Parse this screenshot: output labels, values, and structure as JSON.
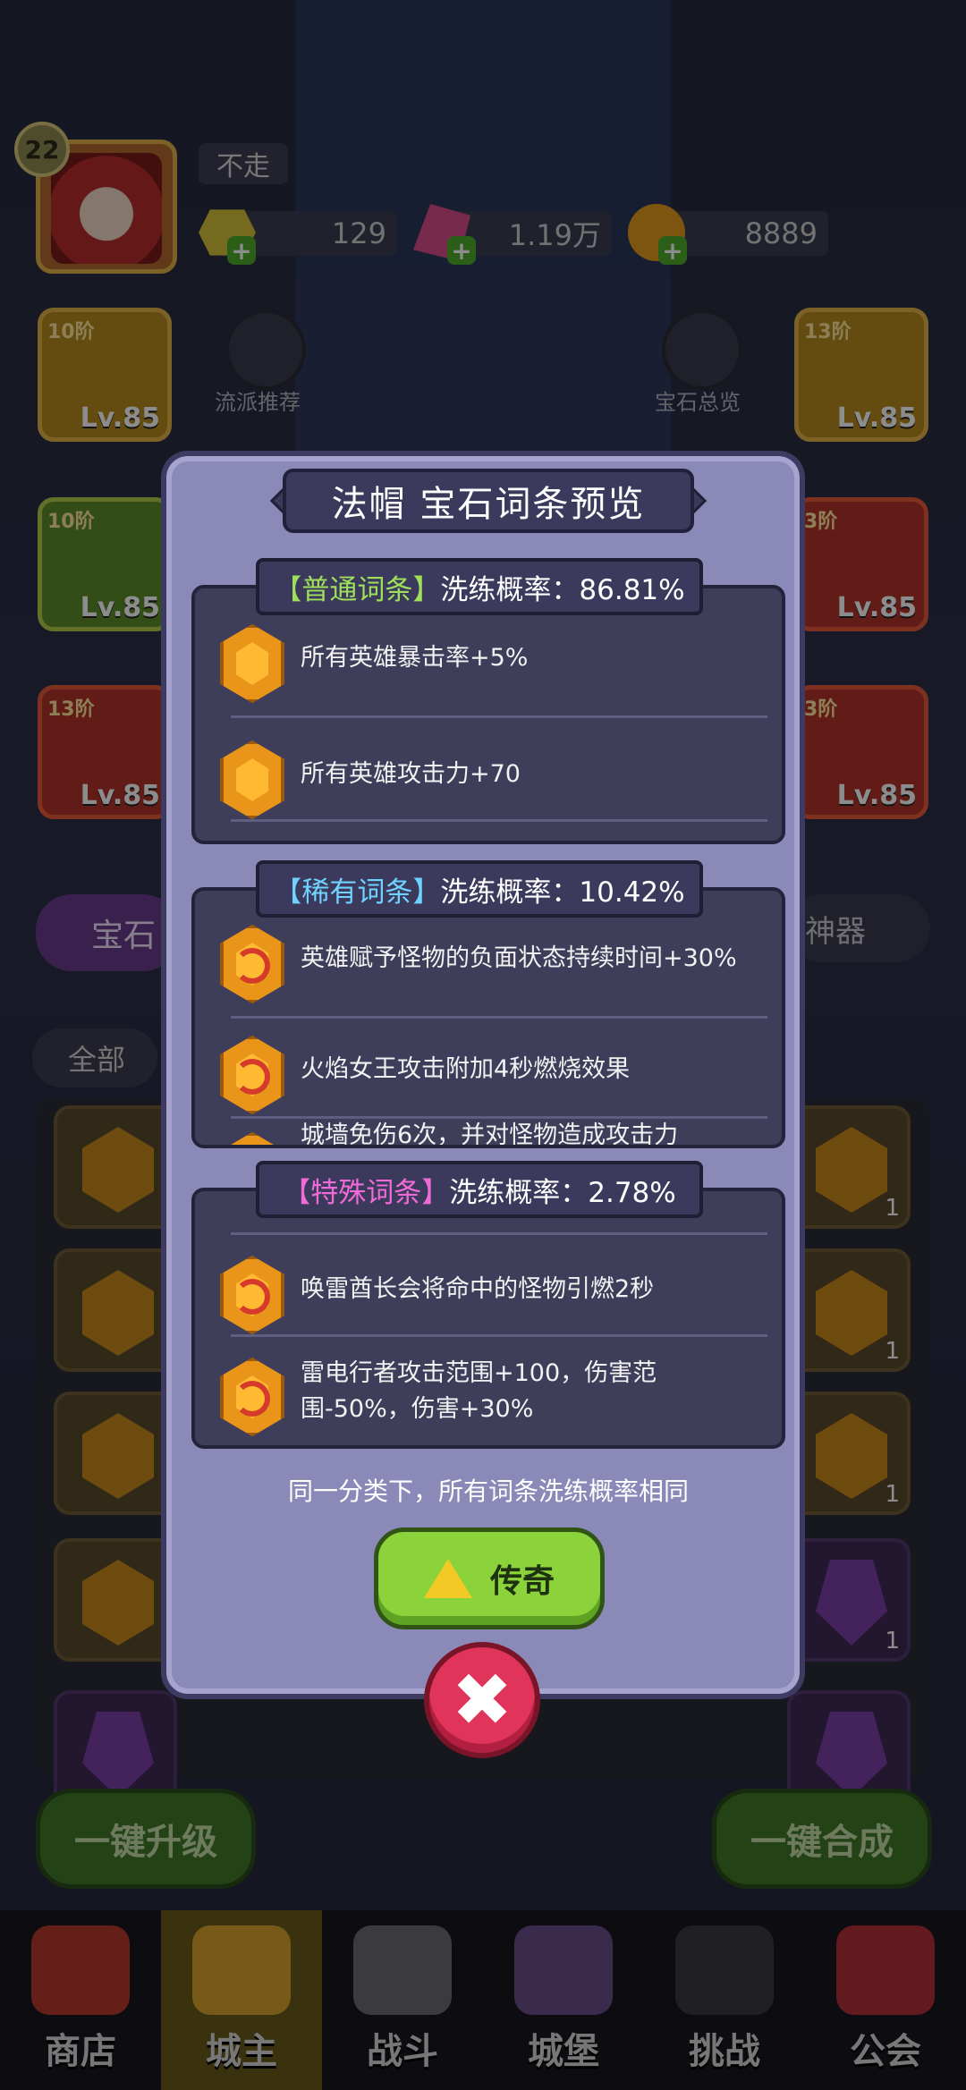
{
  "player": {
    "level": "22",
    "name": "不走",
    "resources": [
      {
        "icon": "yellow-gem-icon",
        "value": "129"
      },
      {
        "icon": "pink-crystal-icon",
        "value": "1.19万"
      },
      {
        "icon": "gold-coin-icon",
        "value": "8889"
      }
    ]
  },
  "equipment": {
    "left": [
      {
        "tier": "10阶",
        "level": "Lv.85"
      },
      {
        "tier": "10阶",
        "level": "Lv.85"
      },
      {
        "tier": "13阶",
        "level": "Lv.85"
      }
    ],
    "right": [
      {
        "tier": "13阶",
        "level": "Lv.85"
      },
      {
        "tier": "3阶",
        "level": "Lv.85"
      },
      {
        "tier": "3阶",
        "level": "Lv.85"
      }
    ],
    "side_buttons": [
      "流派推荐",
      "宝石总览"
    ]
  },
  "tabs": {
    "left": "宝石",
    "right": "神器",
    "filter": "全部"
  },
  "bottom_buttons": {
    "upgrade": "一键升级",
    "compose": "一键合成"
  },
  "nav": [
    "商店",
    "城主",
    "战斗",
    "城堡",
    "挑战",
    "公会"
  ],
  "modal": {
    "title": "法帽 宝石词条预览",
    "sections": [
      {
        "tag": "普通词条",
        "rate_label": "洗练概率：86.81%",
        "items": [
          "所有英雄暴击率+5%",
          "所有英雄攻击力+70"
        ]
      },
      {
        "tag": "稀有词条",
        "rate_label": "洗练概率：10.42%",
        "items": [
          "英雄赋予怪物的负面状态持续时间+30%",
          "火焰女王攻击附加4秒燃烧效果",
          "城墙免伤6次，并对怪物造成攻击力"
        ]
      },
      {
        "tag": "特殊词条",
        "rate_label": "洗练概率：2.78%",
        "items": [
          "唤雷酋长会将命中的怪物引燃2秒",
          "雷电行者攻击范围+100，伤害范围-50%，伤害+30%"
        ]
      }
    ],
    "footnote": "同一分类下，所有词条洗练概率相同",
    "action_button": "传奇",
    "colors": {
      "common": "#9ee05a",
      "rare": "#6fd2ff",
      "special": "#f06bd8"
    }
  }
}
